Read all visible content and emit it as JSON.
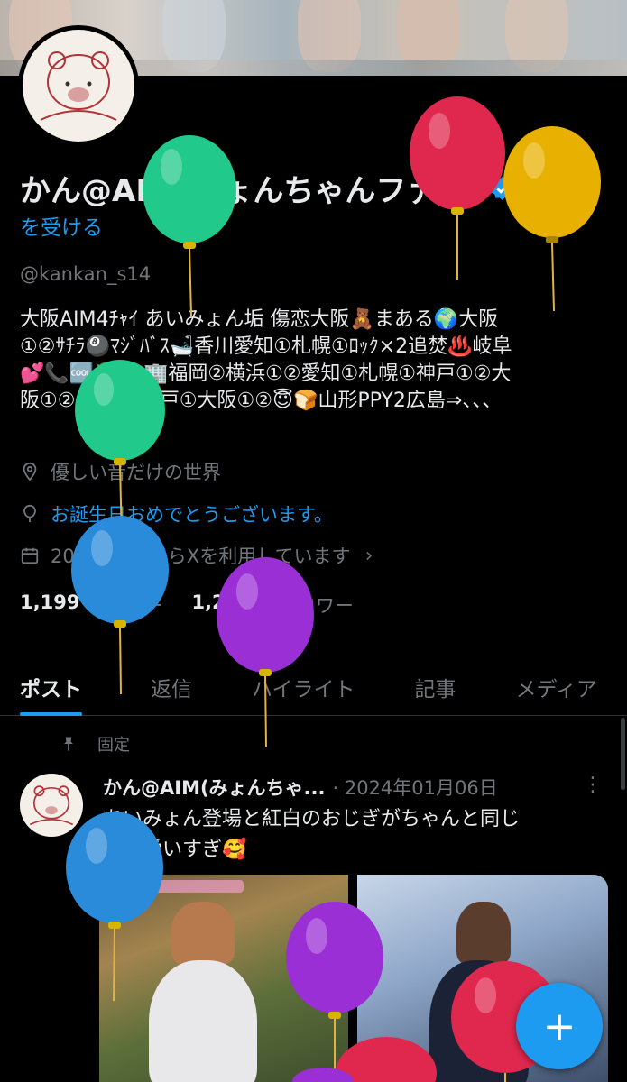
{
  "profile": {
    "display_name": "かん@AIM(みょんちゃんファン)",
    "verify_label": "認証",
    "get_verified": "を受ける",
    "handle": "@kankan_s14",
    "bio_lines": [
      "大阪AIM4ﾁｬｲ あいみょん垢 傷恋大阪🧸まある🌍大阪",
      "①②ｻﾁﾗ🎱ﾏｼﾞﾊﾞｽ🛁香川愛知①札幌①ﾛｯｸ×2追焚♨️岐阜",
      "💕📞🆒🍒💫🏢福岡②横浜①②愛知①札幌①神戸①②大",
      "阪①②🗝️増築神戸①大阪①②😇🍞山形PPY2広島⇒、、、"
    ],
    "location": "優しい音だけの世界",
    "birthday": "お誕生日おめでとうございます。",
    "joined": "2022年7月からXを利用しています",
    "following_count": "1,199",
    "following_label": "フォロー",
    "followers_count": "1,239",
    "followers_label": "フォロワー"
  },
  "tabs": [
    {
      "label": "ポスト"
    },
    {
      "label": "返信"
    },
    {
      "label": "ハイライト"
    },
    {
      "label": "記事"
    },
    {
      "label": "メディア"
    }
  ],
  "post": {
    "pinned_label": "固定",
    "author": "かん@AIM(みょんちゃ...",
    "date": "· 2024年01月06日",
    "more": "⋮",
    "text_line1": "あいみょん登場と紅白のおじぎがちゃんと同じ",
    "text_line2": "で可愛いすぎ🥰"
  },
  "fab_label": "+",
  "colors": {
    "accent": "#1d9bf0",
    "balloon_green": "#21c98a",
    "balloon_red": "#e0284e",
    "balloon_yellow": "#e8b000",
    "balloon_blue": "#2a8bdb",
    "balloon_purple": "#9a2fd6"
  }
}
